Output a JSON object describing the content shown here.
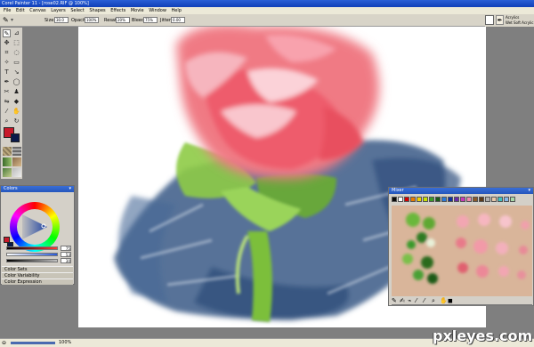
{
  "window": {
    "title": "Corel Painter 11 - [rose02.RIF @ 100%]"
  },
  "menu": [
    "File",
    "Edit",
    "Canvas",
    "Layers",
    "Select",
    "Shapes",
    "Effects",
    "Movie",
    "Window",
    "Help"
  ],
  "property_bar": {
    "size_label": "Size:",
    "size_value": "30.0",
    "opacity_label": "Opacity:",
    "opacity_value": "100%",
    "resat_label": "Resat:",
    "resat_value": "20%",
    "bleed_label": "Bleed:",
    "bleed_value": "75%",
    "jitter_label": "Jitter:",
    "jitter_value": "0.00"
  },
  "brush_selector": {
    "category": "Acrylics",
    "variant": "Wet Soft Acrylic"
  },
  "color_panel": {
    "title": "Colors",
    "slider_values": [
      "75",
      "53",
      "30"
    ],
    "sections": [
      "Color Sets",
      "Color Variability",
      "Color Expression"
    ]
  },
  "mixer": {
    "title": "Mixer",
    "swatch_colors": [
      "#0a0a0a",
      "#ffffff",
      "#d40000",
      "#e87a00",
      "#f0d000",
      "#c8e000",
      "#3a9a2a",
      "#1a5a1a",
      "#2a7ad8",
      "#1030a0",
      "#6a2aa8",
      "#c83ab8",
      "#f08ab0",
      "#8a5a2a",
      "#5a3a1a",
      "#b0b0b0",
      "#e8c8a8",
      "#40c0c0",
      "#8ab8e8",
      "#a8d8a8"
    ]
  },
  "status": {
    "zoom": "100%"
  },
  "watermark": {
    "text": "pxleyes.com"
  },
  "colors": {
    "primary": "#c8192a",
    "secondary": "#0a1a4a",
    "canvas": "#ffffff",
    "workspace": "#7f7f7f"
  }
}
